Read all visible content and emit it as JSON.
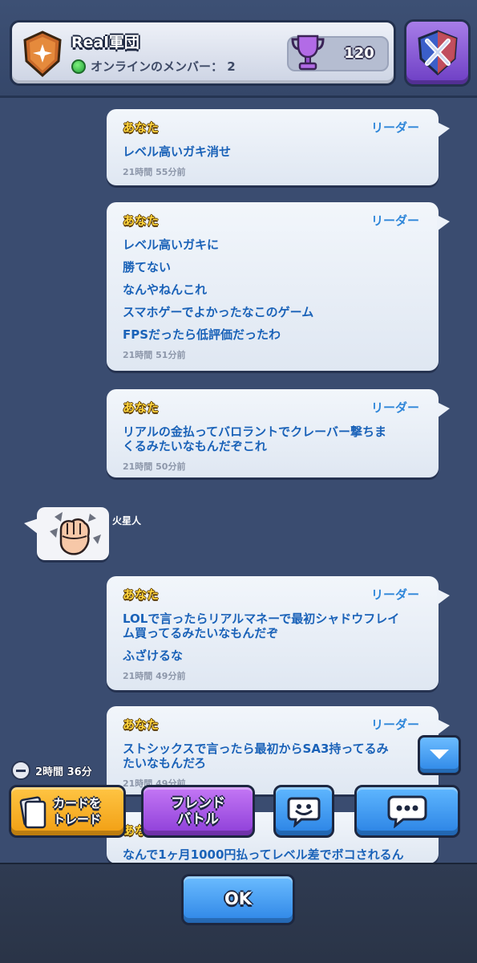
{
  "header": {
    "clan_name": "Real軍団",
    "online_label": "オンラインのメンバー： 2",
    "trophies": "120"
  },
  "messages": [
    {
      "sender": "あなた",
      "role": "リーダー",
      "lines": [
        "レベル高いガキ消せ"
      ],
      "time": "21時間 55分前"
    },
    {
      "sender": "あなた",
      "role": "リーダー",
      "lines": [
        "レベル高いガキに",
        "勝てない",
        "なんやねんこれ",
        "スマホゲーでよかったなこのゲーム",
        "FPSだったら低評価だったわ"
      ],
      "time": "21時間 51分前"
    },
    {
      "sender": "あなた",
      "role": "リーダー",
      "lines": [
        "リアルの金払ってバロラントでクレーバー撃ちま",
        "くるみたいなもんだぞこれ"
      ],
      "time": "21時間 50分前"
    },
    {
      "sender": "あなた",
      "role": "リーダー",
      "lines": [
        "LOLで言ったらリアルマネーで最初シャドウフレイ",
        "ム買ってるみたいなもんだぞ",
        "ふざけるな"
      ],
      "time": "21時間 49分前"
    },
    {
      "sender": "あなた",
      "role": "リーダー",
      "lines": [
        "ストシックスで言ったら最初からSA3持ってるみ",
        "たいなもんだろ"
      ],
      "time": "21時間 49分前"
    },
    {
      "sender": "あなた",
      "lines": [
        "なんで1ヶ月1000円払ってレベル差でボコされるん"
      ]
    }
  ],
  "emote_message": {
    "sender": "火星人",
    "emote": "fist-emote"
  },
  "actions": {
    "timer": "2時間 36分",
    "trade_label_1": "カードを",
    "trade_label_2": "トレード",
    "friend_label_1": "フレンド",
    "friend_label_2": "バトル",
    "ok_label": "OK"
  },
  "colors": {
    "background": "#3a4c70",
    "sender": "#ffd53d",
    "role": "#2e86d9",
    "message_text": "#1a62b8",
    "trade_button": "#f19e12",
    "friend_button": "#8d3ed8",
    "blue_button": "#2a82e4"
  },
  "icons": [
    "clan-badge-icon",
    "trophy-icon",
    "clan-wars-icon",
    "online-dot-icon",
    "timer-icon",
    "card-icon",
    "emote-face-icon",
    "chat-bubble-icon",
    "chevron-down-icon"
  ]
}
